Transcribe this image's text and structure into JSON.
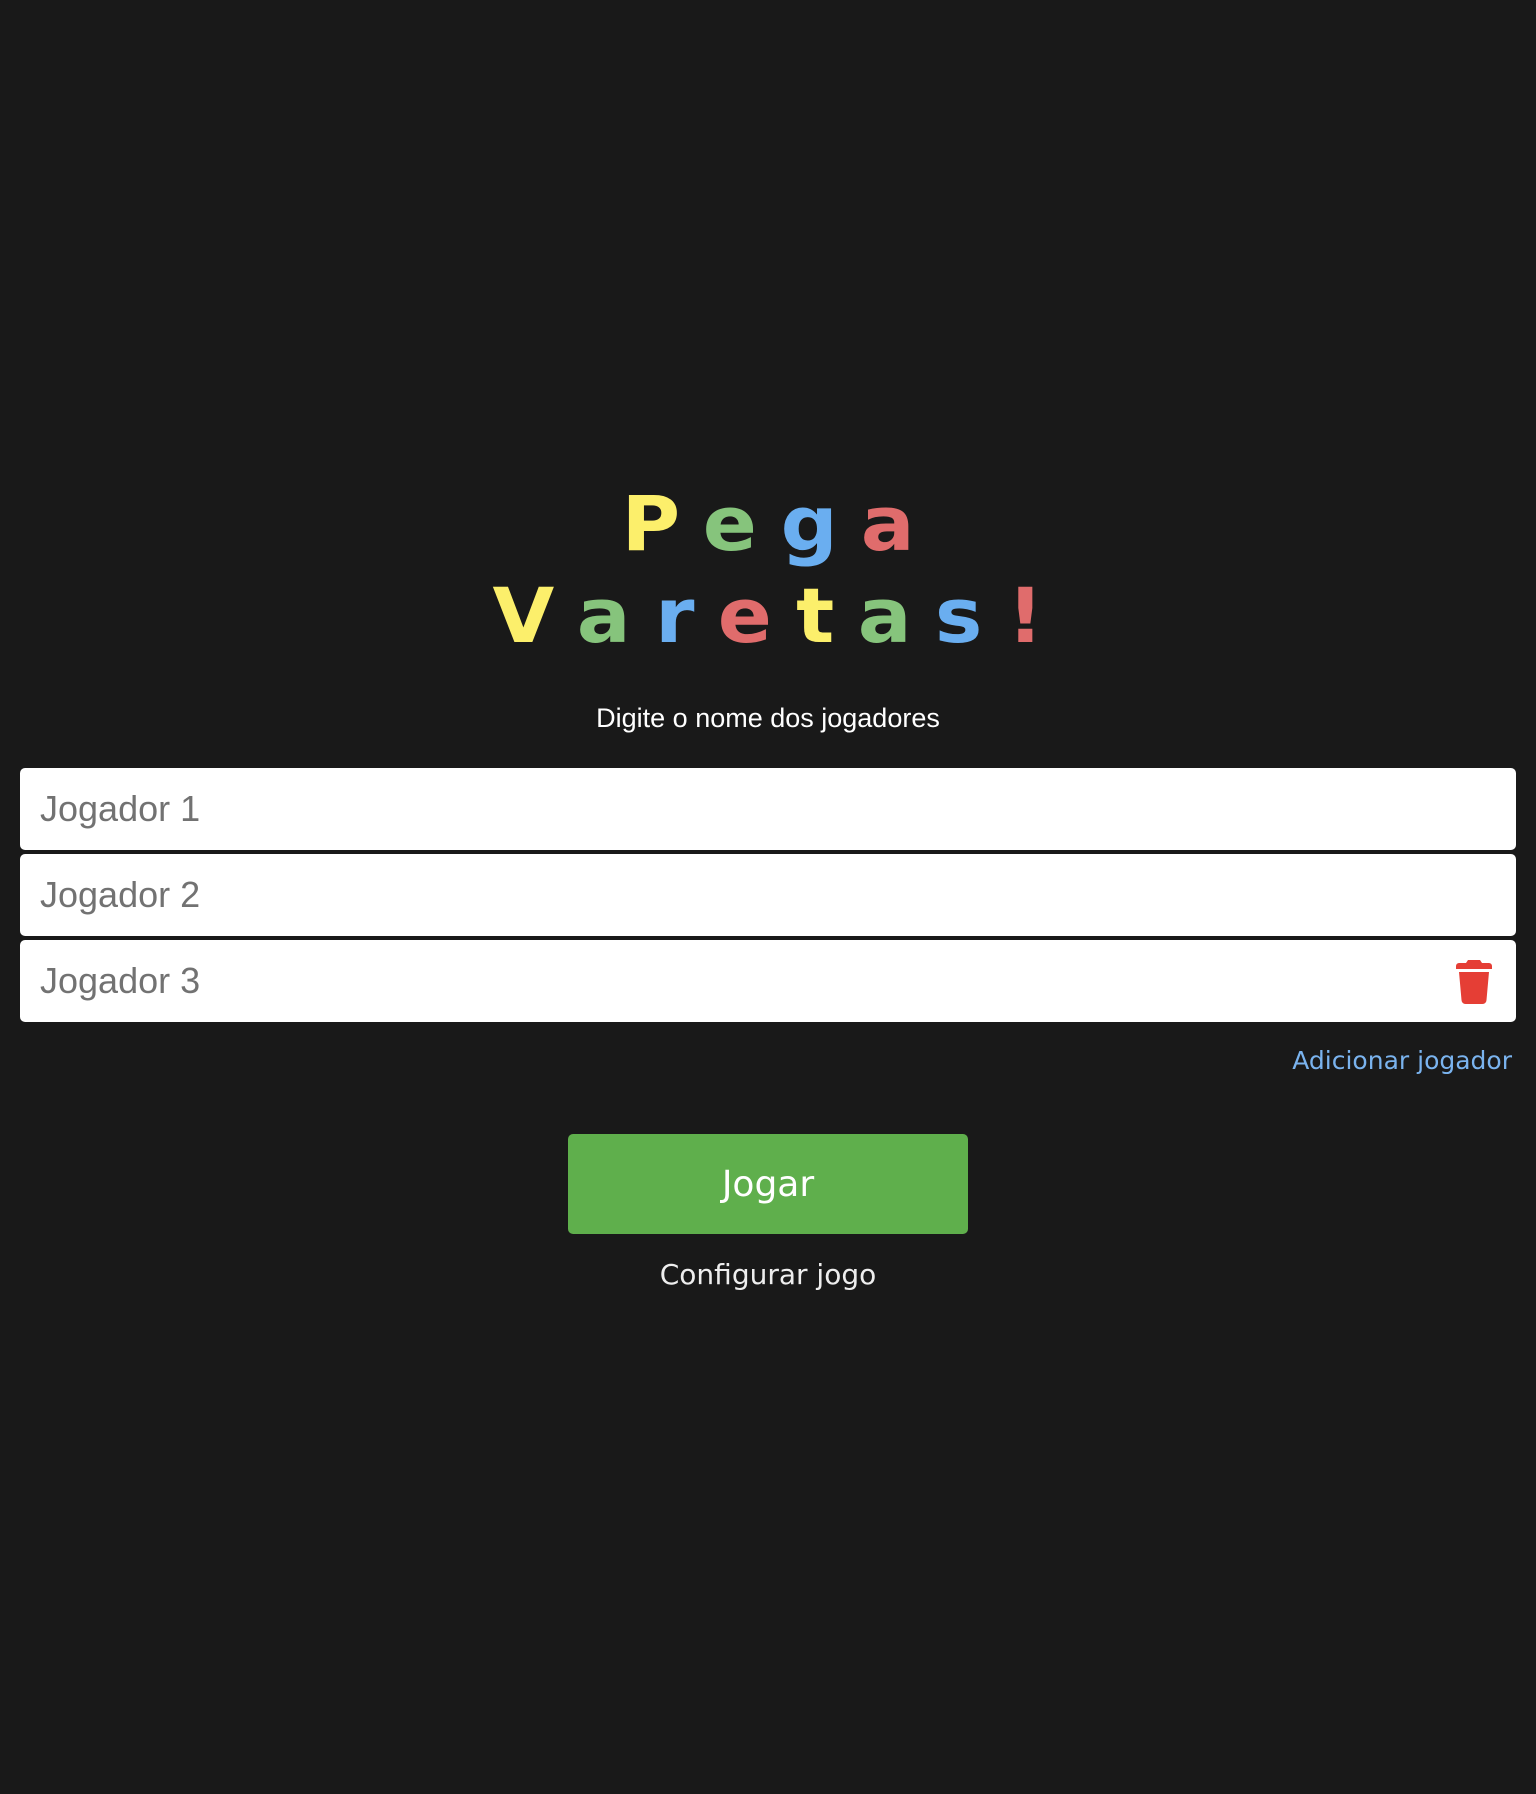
{
  "title": {
    "line1": [
      {
        "char": "P",
        "color": "#fcef6b"
      },
      {
        "char": "e",
        "color": "#86c47c"
      },
      {
        "char": "g",
        "color": "#6aaef0"
      },
      {
        "char": "a",
        "color": "#e06c6c"
      }
    ],
    "line2": [
      {
        "char": "V",
        "color": "#fcef6b"
      },
      {
        "char": "a",
        "color": "#86c47c"
      },
      {
        "char": "r",
        "color": "#6aaef0"
      },
      {
        "char": "e",
        "color": "#e06c6c"
      },
      {
        "char": "t",
        "color": "#fcef6b"
      },
      {
        "char": "a",
        "color": "#86c47c"
      },
      {
        "char": "s",
        "color": "#6aaef0"
      },
      {
        "char": "!",
        "color": "#e06c6c"
      }
    ]
  },
  "subtitle": "Digite o nome dos jogadores",
  "players": [
    {
      "placeholder": "Jogador 1",
      "value": "",
      "deletable": false
    },
    {
      "placeholder": "Jogador 2",
      "value": "",
      "deletable": false
    },
    {
      "placeholder": "Jogador 3",
      "value": "",
      "deletable": true,
      "delete_icon": "trash-icon"
    }
  ],
  "add_player_label": "Adicionar jogador",
  "play_label": "Jogar",
  "config_label": "Configurar jogo",
  "colors": {
    "background": "#191919",
    "play_button": "#5faf4c",
    "link": "#7ab3ee",
    "delete": "#e53e35"
  }
}
